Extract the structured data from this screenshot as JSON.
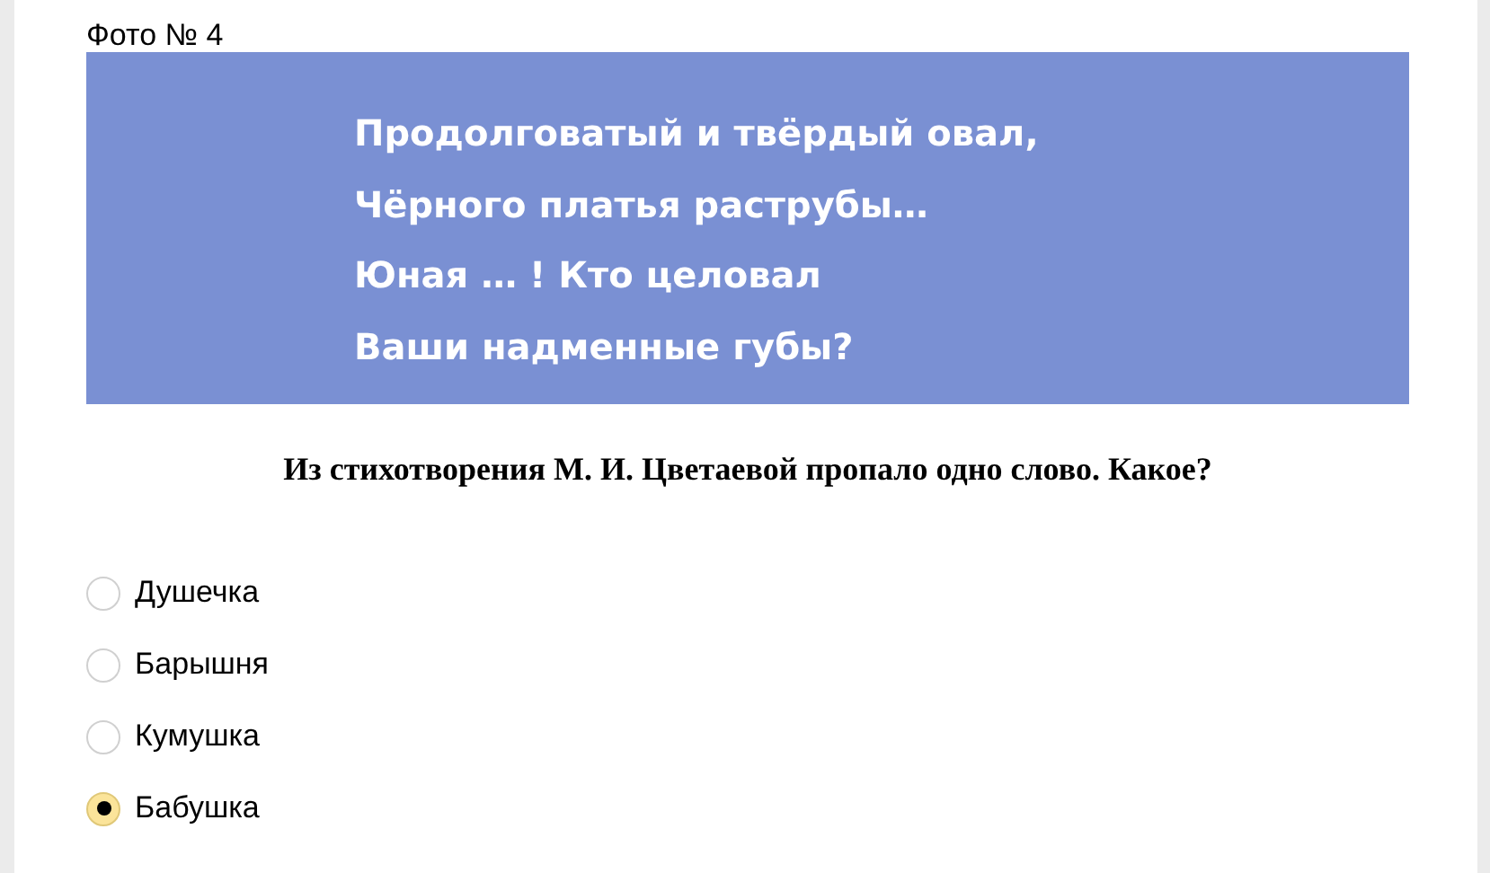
{
  "title": "Фото № 4",
  "poem_card": {
    "lines": [
      "Продолговатый и твёрдый овал,",
      "Чёрного платья раструбы…",
      "Юная … ! Кто целовал",
      "Ваши надменные губы?"
    ]
  },
  "question": "Из стихотворения М. И. Цветаевой пропало одно слово. Какое?",
  "options": [
    {
      "label": "Душечка",
      "selected": false
    },
    {
      "label": "Барышня",
      "selected": false
    },
    {
      "label": "Кумушка",
      "selected": false
    },
    {
      "label": "Бабушка",
      "selected": true
    }
  ]
}
